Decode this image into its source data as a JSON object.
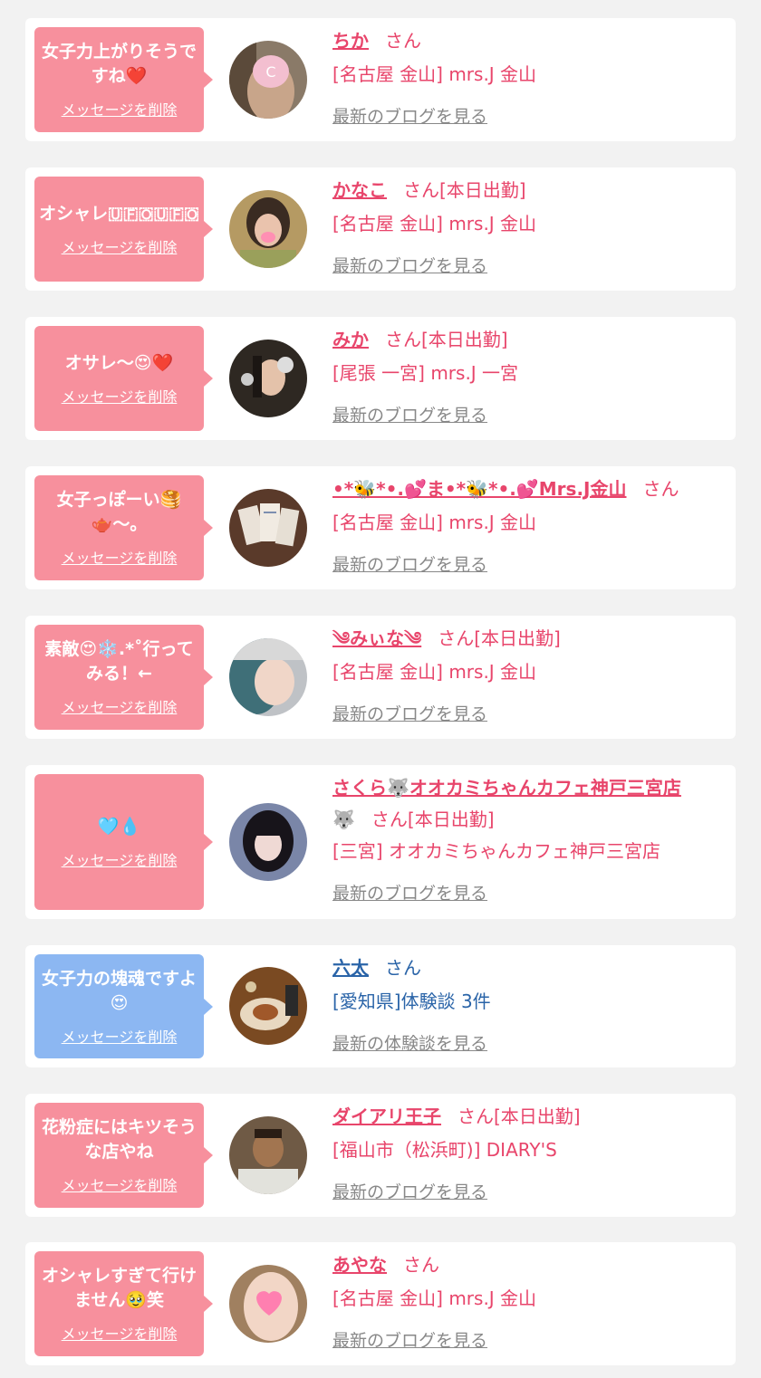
{
  "delete_label": "メッセージを削除",
  "san": "さん",
  "colors": {
    "pink_bubble": "#f7909d",
    "blue_bubble": "#8cb7f2",
    "name_pink": "#e8456b",
    "name_blue": "#2a64a8"
  },
  "cards": [
    {
      "message": "女子力上がりそうですね❤️",
      "name": "ちか",
      "suffix": "さん",
      "shop": "[名古屋 金山] mrs.J 金山",
      "link": "最新のブログを見る"
    },
    {
      "message": "オシャレ🇺​🇫​🇴​🇺​🇫​🇴",
      "name": "かなこ",
      "suffix": "さん[本日出勤]",
      "shop": "[名古屋 金山] mrs.J 金山",
      "link": "最新のブログを見る"
    },
    {
      "message": "オサレ〜😍❤️",
      "name": "みか",
      "suffix": "さん[本日出勤]",
      "shop": "[尾張 一宮] mrs.J 一宮",
      "link": "最新のブログを見る"
    },
    {
      "message": "女子っぽーい🥞🫖〜。",
      "name": "•*🐝*•.💕ま•*🐝*•.💕Mrs.J金山",
      "suffix": "さん",
      "shop": "[名古屋 金山] mrs.J 金山",
      "link": "最新のブログを見る"
    },
    {
      "message": "素敵😍❄️.*˚行ってみる！←",
      "name": "༄みぃな༄",
      "suffix": "さん[本日出勤]",
      "shop": "[名古屋 金山] mrs.J 金山",
      "link": "最新のブログを見る"
    },
    {
      "message": "🩵💧",
      "name": "さくら🐺オオカミちゃんカフェ神戸三宮店",
      "name2": "🐺",
      "suffix": "さん[本日出勤]",
      "shop": "[三宮] オオカミちゃんカフェ神戸三宮店",
      "link": "最新のブログを見る"
    },
    {
      "message": "女子力の塊魂ですよ😍",
      "name": "六太",
      "suffix": "さん",
      "shop": "[愛知県]体験談 3件",
      "link": "最新の体験談を見る"
    },
    {
      "message": "花粉症にはキツそうな店やね",
      "name": "ダイアリ王子",
      "suffix": "さん[本日出勤]",
      "shop": "[福山市（松浜町)] DIARY'S",
      "link": "最新のブログを見る"
    },
    {
      "message": "オシャレすぎて行けません🥹笑",
      "name": "あやな",
      "suffix": "さん",
      "shop": "[名古屋 金山] mrs.J 金山",
      "link": "最新のブログを見る"
    }
  ]
}
